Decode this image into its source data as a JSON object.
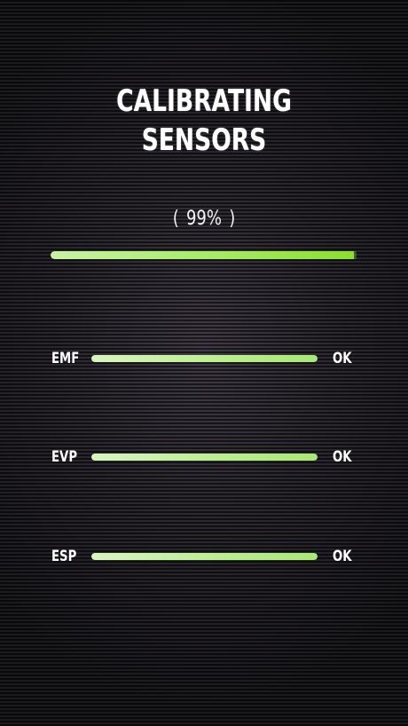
{
  "header": {
    "title_line1": "CALIBRATING",
    "title_line2": "SENSORS"
  },
  "progress": {
    "bracket_open": "(",
    "percent_text": "99%",
    "bracket_close": ")",
    "value": 0.99
  },
  "sensors": [
    {
      "label": "EMF",
      "status": "OK",
      "level": 1.0
    },
    {
      "label": "EVP",
      "status": "OK",
      "level": 1.0
    },
    {
      "label": "ESP",
      "status": "OK",
      "level": 1.0
    }
  ],
  "colors": {
    "accent": "#8ae02c",
    "bar_light": "#c9f2a6",
    "background": "#1c1a1f",
    "text": "#ffffff"
  }
}
